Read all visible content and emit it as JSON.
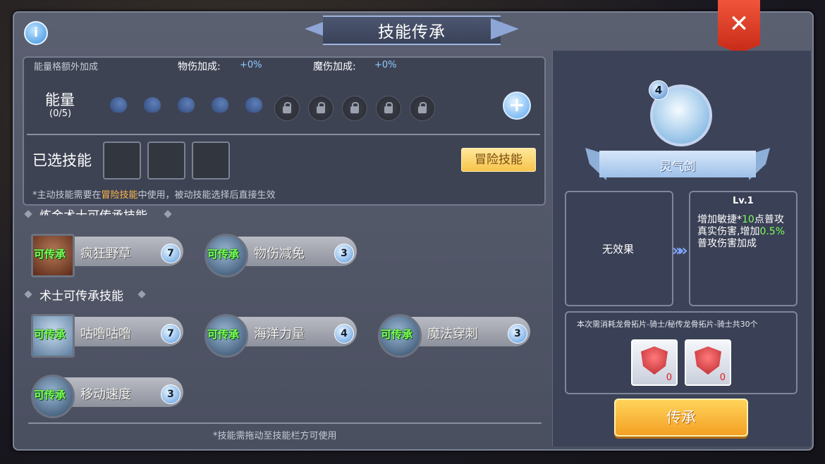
{
  "header": {
    "title": "技能传承",
    "close_glyph": "✕",
    "info_glyph": "i"
  },
  "energy_panel": {
    "bonus_label": "能量格额外加成",
    "phys_label": "物伤加成:",
    "phys_value": "+0%",
    "magic_label": "魔伤加成:",
    "magic_value": "+0%",
    "energy_label": "能量",
    "energy_count": "(0/5)",
    "filled_slots": 5,
    "locked_slots": 5,
    "plus_glyph": "+",
    "selected_label": "已选技能",
    "adventure_button": "冒险技能",
    "note_prefix": "*主动技能需要在",
    "note_highlight": "冒险技能",
    "note_suffix": "中使用，被动技能选择后直接生效"
  },
  "sections": [
    {
      "title": "炼金术士可传承技能",
      "skills": [
        {
          "tag": "可传承",
          "name": "疯狂野草",
          "level": "7"
        },
        {
          "tag": "可传承",
          "name": "物伤减免",
          "level": "3"
        }
      ]
    },
    {
      "title": "术士可传承技能",
      "skills": [
        {
          "tag": "可传承",
          "name": "咕噜咕噜",
          "level": "7"
        },
        {
          "tag": "可传承",
          "name": "海洋力量",
          "level": "4"
        },
        {
          "tag": "可传承",
          "name": "魔法穿刺",
          "level": "3"
        },
        {
          "tag": "可传承",
          "name": "移动速度",
          "level": "3"
        }
      ]
    }
  ],
  "bottom_note": "*技能需拖动至技能栏方可使用",
  "detail": {
    "skill_level_badge": "4",
    "skill_name": "灵气剑",
    "current_effect": "无效果",
    "arrow_glyph": "»",
    "next_level": "Lv.1",
    "next_effect_1": "增加敏捷*",
    "next_effect_2": "10",
    "next_effect_3": "点普攻真实伤害,增加",
    "next_effect_4": "0.5%",
    "next_effect_5": "普攻伤害加成",
    "cost_text": "本次需消耗龙骨拓片-骑士/秘传龙骨拓片-骑士共30个",
    "cost_items": [
      {
        "count": "0"
      },
      {
        "count": "0"
      }
    ],
    "inherit_button": "传承"
  },
  "colors": {
    "accent_green": "#7cff5a",
    "highlight_orange": "#ffb84a",
    "button_yellow": "#f6c44a",
    "close_red": "#d8341f"
  }
}
